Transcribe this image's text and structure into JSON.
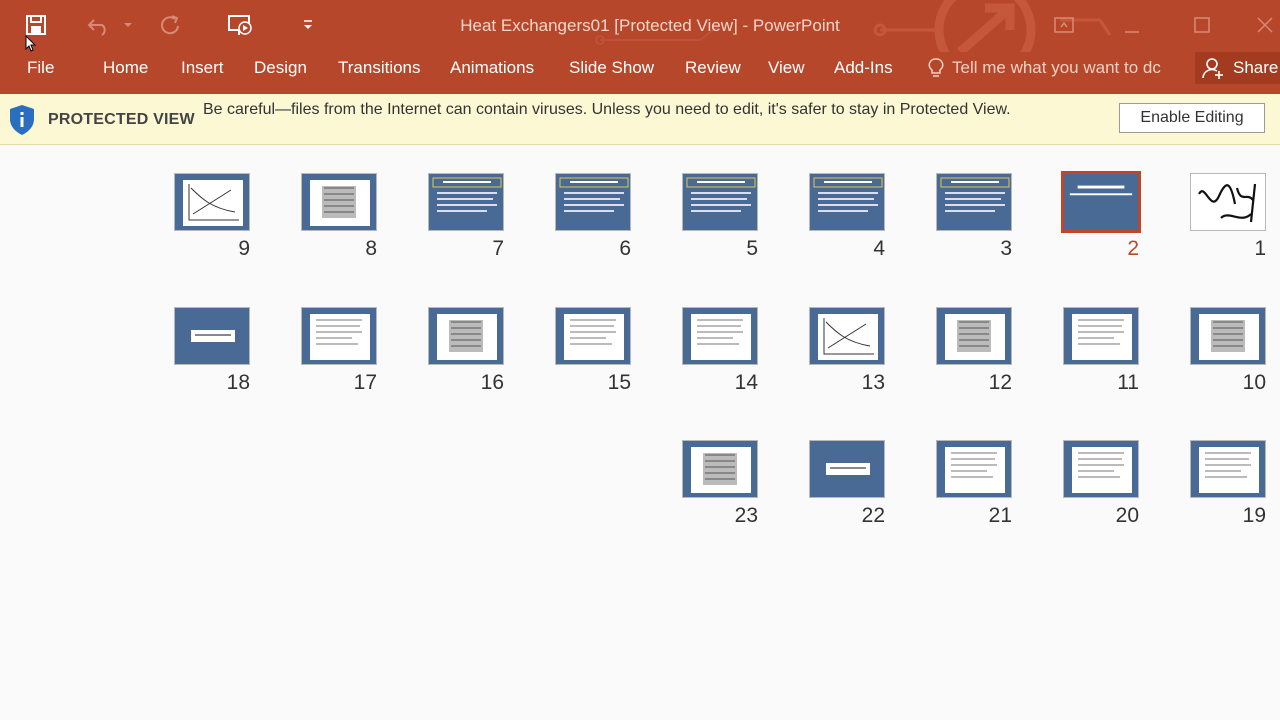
{
  "app": {
    "title": "Heat Exchangers01 [Protected View] - PowerPoint"
  },
  "ribbon": {
    "tabs": [
      "File",
      "Home",
      "Insert",
      "Design",
      "Transitions",
      "Animations",
      "Slide Show",
      "Review",
      "View",
      "Add-Ins"
    ],
    "tell_me": "Tell me what you want to dc",
    "share": "Share"
  },
  "protected_view": {
    "label": "PROTECTED VIEW",
    "message": "Be careful—files from the Internet can contain viruses. Unless you need to edit, it's safer to stay in Protected View.",
    "enable_button": "Enable Editing"
  },
  "slides": [
    {
      "number": "1",
      "kind": "calligraphy"
    },
    {
      "number": "2",
      "kind": "title",
      "selected": true
    },
    {
      "number": "3",
      "kind": "text"
    },
    {
      "number": "4",
      "kind": "text"
    },
    {
      "number": "5",
      "kind": "text"
    },
    {
      "number": "6",
      "kind": "text"
    },
    {
      "number": "7",
      "kind": "text"
    },
    {
      "number": "8",
      "kind": "image"
    },
    {
      "number": "9",
      "kind": "graph"
    },
    {
      "number": "10",
      "kind": "image"
    },
    {
      "number": "11",
      "kind": "doc"
    },
    {
      "number": "12",
      "kind": "image"
    },
    {
      "number": "13",
      "kind": "graph"
    },
    {
      "number": "14",
      "kind": "doc"
    },
    {
      "number": "15",
      "kind": "doc"
    },
    {
      "number": "16",
      "kind": "image"
    },
    {
      "number": "17",
      "kind": "doc"
    },
    {
      "number": "18",
      "kind": "strip"
    },
    {
      "number": "19",
      "kind": "doc"
    },
    {
      "number": "20",
      "kind": "doc"
    },
    {
      "number": "21",
      "kind": "doc"
    },
    {
      "number": "22",
      "kind": "strip"
    },
    {
      "number": "23",
      "kind": "image"
    }
  ],
  "colors": {
    "accent": "#b7472a",
    "protected_bar": "#fcf8d4",
    "slide_bg": "#4a6a96",
    "selected": "#c0462a"
  },
  "icons": {
    "save": "save-icon",
    "undo": "undo-icon",
    "redo": "redo-icon",
    "present": "present-from-beginning-icon",
    "customize": "customize-qat-icon",
    "lightbulb": "lightbulb-icon",
    "share": "share-person-icon",
    "shield": "shield-icon"
  }
}
